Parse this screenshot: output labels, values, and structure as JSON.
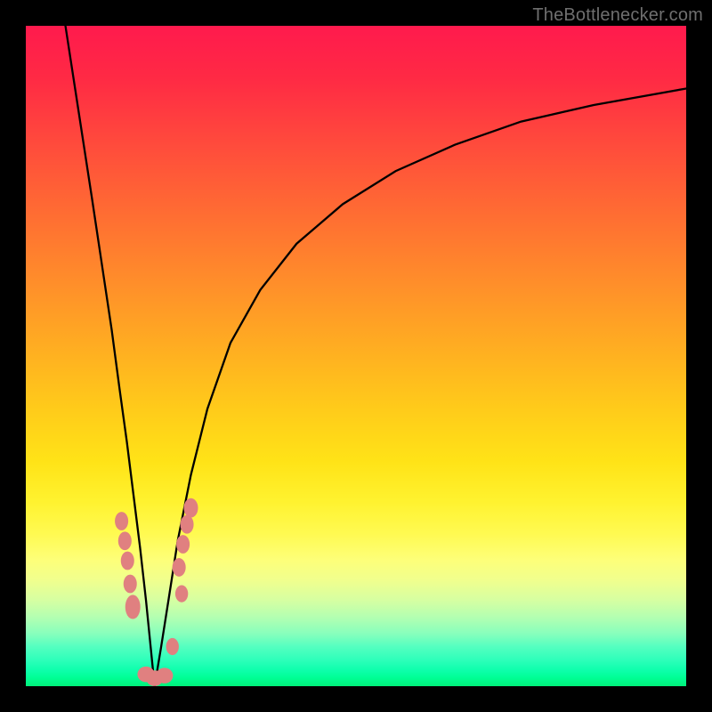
{
  "watermark": "TheBottlenecker.com",
  "colors": {
    "frame": "#000000",
    "curve": "#000000",
    "marker_fill": "#e08080",
    "marker_stroke": "#d06868",
    "gradient_top": "#ff1a4d",
    "gradient_bottom": "#00f07a"
  },
  "chart_data": {
    "type": "line",
    "title": "",
    "xlabel": "",
    "ylabel": "",
    "xlim": [
      0,
      100
    ],
    "ylim": [
      0,
      100
    ],
    "grid": false,
    "legend": false,
    "axes_visible": false,
    "x_notch": 19.5,
    "series": [
      {
        "name": "left-branch",
        "x": [
          6.0,
          8.0,
          10.0,
          11.5,
          13.0,
          14.2,
          15.3,
          16.3,
          17.3,
          18.2,
          18.9,
          19.5
        ],
        "values": [
          100,
          87,
          74,
          64,
          54,
          45,
          37,
          29,
          21,
          13,
          6,
          0
        ]
      },
      {
        "name": "right-branch",
        "x": [
          19.5,
          20.5,
          21.6,
          23.0,
          25.0,
          27.5,
          31.0,
          35.5,
          41.0,
          48.0,
          56.0,
          65.0,
          75.0,
          86.0,
          100.0
        ],
        "values": [
          0,
          6,
          13,
          22,
          32,
          42,
          52,
          60,
          67,
          73,
          78,
          82,
          85.5,
          88,
          90.5
        ]
      }
    ],
    "markers": {
      "name": "data-points",
      "x": [
        14.5,
        15.0,
        15.4,
        15.8,
        16.2,
        18.2,
        19.5,
        21.0,
        22.2,
        23.6,
        23.2,
        23.8,
        24.4,
        25.0
      ],
      "values": [
        25.0,
        22.0,
        19.0,
        15.5,
        12.0,
        1.8,
        1.2,
        1.6,
        6.0,
        14.0,
        18.0,
        21.5,
        24.5,
        27.0
      ],
      "rx": [
        4.7,
        4.7,
        4.7,
        4.7,
        5.3,
        6.0,
        6.0,
        6.0,
        4.5,
        4.5,
        4.7,
        4.7,
        4.7,
        5.0
      ],
      "ry": [
        6.5,
        6.5,
        6.5,
        6.5,
        8.5,
        5.5,
        5.5,
        5.5,
        6.0,
        6.0,
        6.5,
        6.5,
        6.5,
        6.8
      ]
    }
  }
}
